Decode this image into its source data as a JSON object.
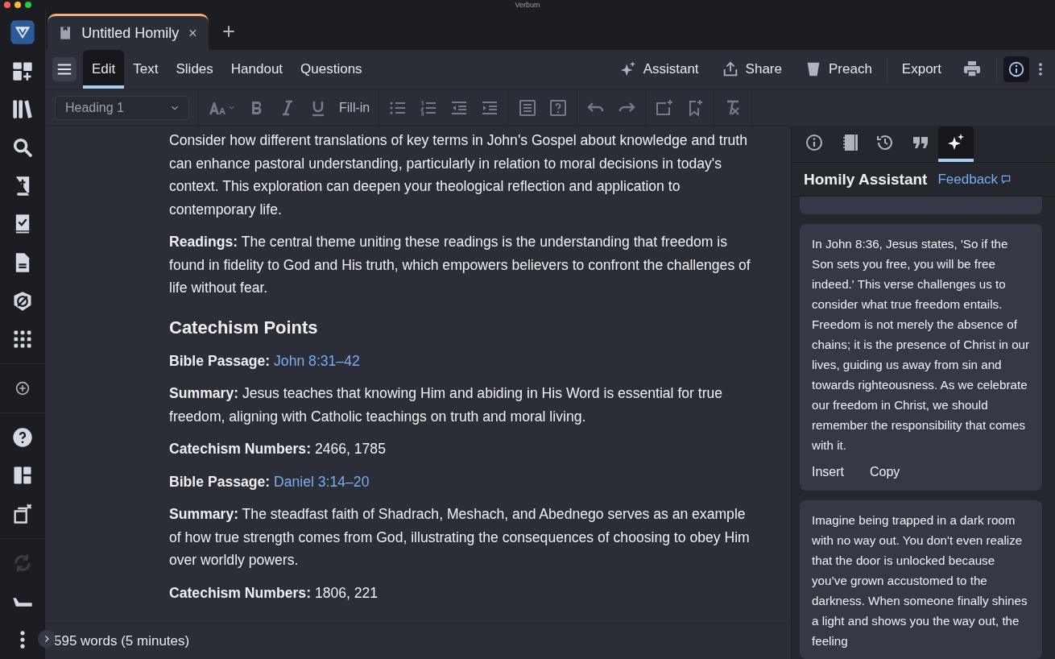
{
  "window": {
    "title": "Verbum"
  },
  "tabs": [
    {
      "label": "Untitled Homily",
      "selected": true
    }
  ],
  "menu_tabs": [
    {
      "label": "Edit",
      "selected": true
    },
    {
      "label": "Text",
      "selected": false
    },
    {
      "label": "Slides",
      "selected": false
    },
    {
      "label": "Handout",
      "selected": false
    },
    {
      "label": "Questions",
      "selected": false
    }
  ],
  "actions": [
    {
      "kind": "assistant",
      "label": "Assistant"
    },
    {
      "kind": "share",
      "label": "Share"
    },
    {
      "kind": "preach",
      "label": "Preach"
    },
    {
      "kind": "export",
      "label": "Export"
    }
  ],
  "info_button": {
    "selected": true
  },
  "format_toolbar": {
    "style": "Heading 1",
    "fill_in": "Fill-in"
  },
  "document": [
    {
      "kind": "paragraph",
      "text": "Consider how different translations of key terms in John's Gospel about knowledge and truth can enhance pastoral understanding, particularly in relation to moral decisions in today's context. This exploration can deepen your theological reflection and application to contemporary life."
    },
    {
      "kind": "paragraph",
      "text": "**Readings:** The central theme uniting these readings is the understanding that freedom is found in fidelity to God and His truth, which empowers believers to confront the challenges of life without fear."
    },
    {
      "kind": "heading",
      "text": "Catechism Points"
    },
    {
      "kind": "passage",
      "label": "Bible Passage:",
      "link": "John 8:31–42"
    },
    {
      "kind": "paragraph",
      "text": "**Summary:** Jesus teaches that knowing Him and abiding in His Word is essential for true freedom, aligning with Catholic teachings on truth and moral living."
    },
    {
      "kind": "paragraph",
      "text": "**Catechism Numbers:** 2466, 1785"
    },
    {
      "kind": "passage",
      "label": "Bible Passage:",
      "link": "Daniel 3:14–20"
    },
    {
      "kind": "paragraph",
      "text": "**Summary:** The steadfast faith of Shadrach, Meshach, and Abednego serves as an example of how true strength comes from God, illustrating the consequences of choosing to obey Him over worldly powers."
    },
    {
      "kind": "paragraph",
      "text": "**Catechism Numbers:** 1806, 221"
    }
  ],
  "panel": {
    "tabs": [
      {
        "kind": "info",
        "selected": false
      },
      {
        "kind": "notebook",
        "selected": false
      },
      {
        "kind": "history",
        "selected": false
      },
      {
        "kind": "quote",
        "selected": false
      },
      {
        "kind": "assistant",
        "selected": true
      }
    ],
    "title": "Homily Assistant",
    "feedback": "Feedback",
    "cards": [
      {
        "text": "In John 8:36, Jesus states, 'So if the Son sets you free, you will be free indeed.' This verse challenges us to consider what true freedom entails. Freedom is not merely the absence of chains; it is the presence of Christ in our lives, guiding us away from sin and towards righteousness. As we celebrate our freedom in Christ, we should remember the responsibility that comes with it.",
        "buttons": [
          "Insert",
          "Copy"
        ]
      },
      {
        "text": "Imagine being trapped in a dark room with no way out. You don't even realize that the door is unlocked because you’ve grown accustomed to the darkness. When someone finally shines a light and shows you the way out, the feeling"
      }
    ]
  },
  "status_bar": {
    "text": "595 words (5 minutes)"
  }
}
